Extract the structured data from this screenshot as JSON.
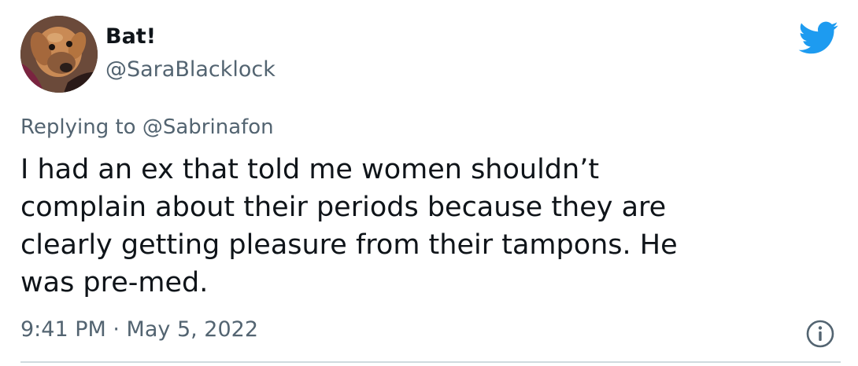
{
  "author": {
    "display_name": "Bat!",
    "handle": "@SaraBlacklock"
  },
  "reply": {
    "prefix": "Replying to ",
    "mention": "@Sabrinafon"
  },
  "tweet": {
    "lines": [
      "I had an ex that told me women shouldn’t",
      "complain about their periods because they are",
      "clearly getting pleasure from their tampons. He",
      "was pre-med."
    ]
  },
  "meta": {
    "time": "9:41 PM",
    "separator": " · ",
    "date": "May 5, 2022"
  },
  "icons": {
    "brand": "twitter-bird-icon",
    "info": "info-icon",
    "avatar": "dog-avatar"
  },
  "colors": {
    "brand_blue": "#1d9bf0",
    "text_primary": "#0f1419",
    "text_secondary": "#536471",
    "divider": "#cfd9de"
  }
}
